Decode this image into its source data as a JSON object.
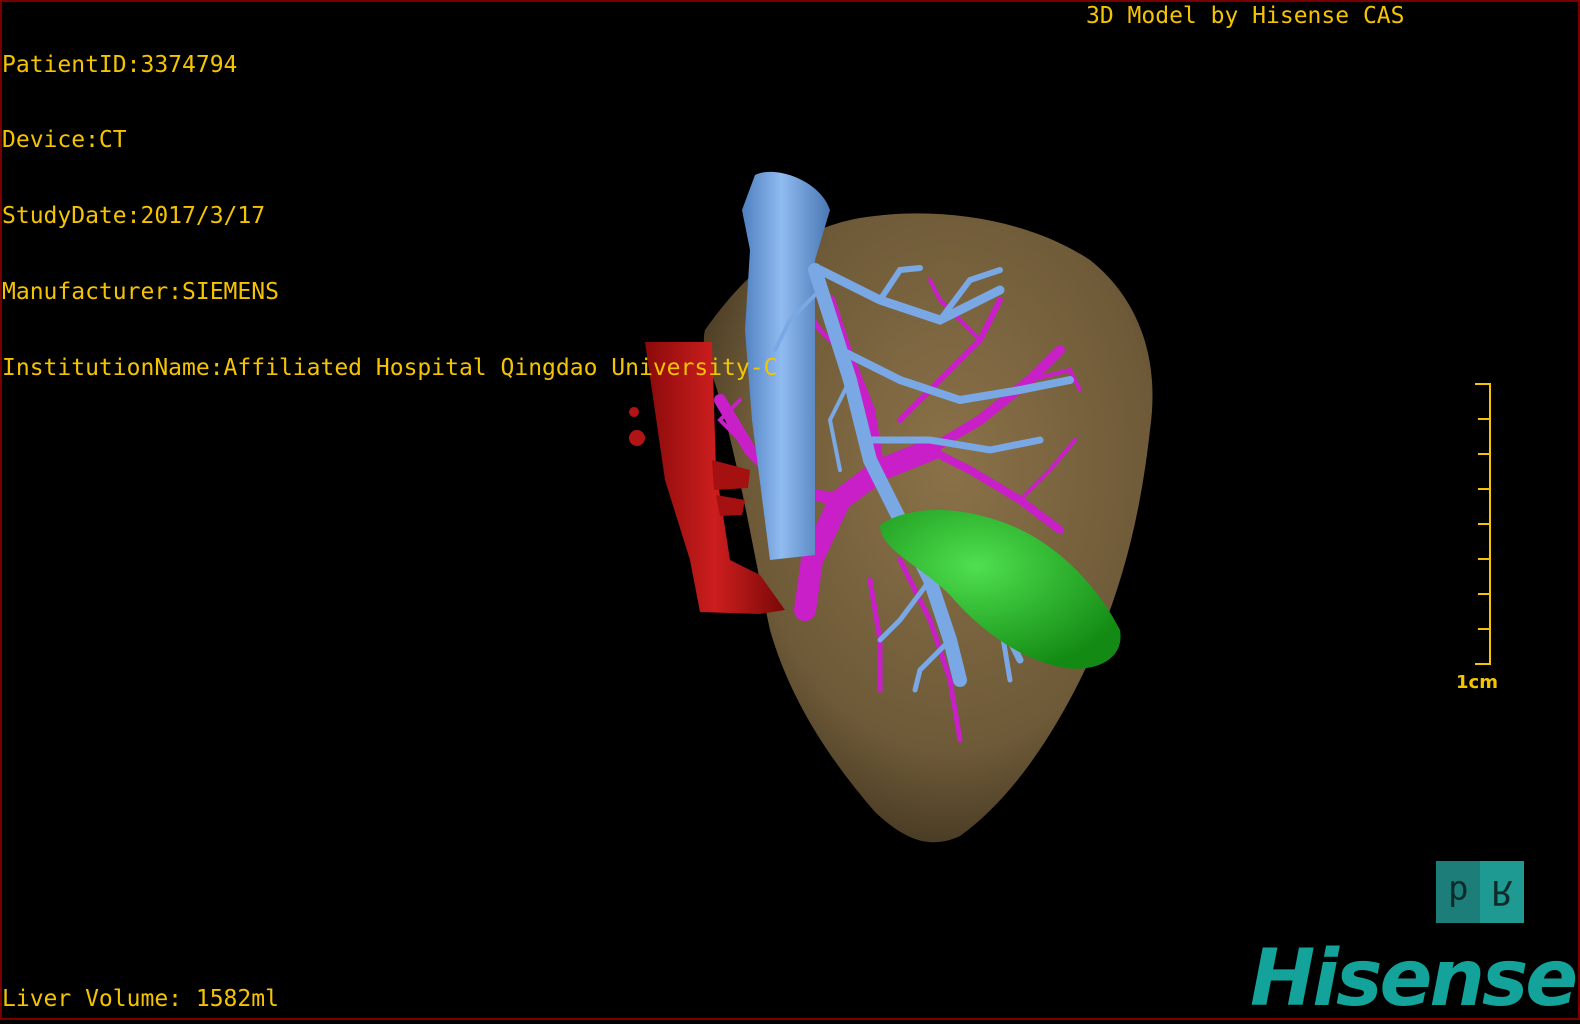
{
  "app": {
    "credit": "3D Model by Hisense CAS",
    "logo": "Hisense"
  },
  "dicom_info": [
    "PatientID:3374794",
    "Device:CT",
    "StudyDate:2017/3/17",
    "Manufacturer:SIEMENS",
    "InstitutionName:Affiliated Hospital Qingdao University-C"
  ],
  "volume_label": "Liver Volume: 1582ml",
  "scale_bar": {
    "label": "1cm"
  },
  "orientation_cube": {
    "left": "d",
    "right": "R",
    "icon": "orientation-cube-icon"
  },
  "colors": {
    "text": "#f5c400",
    "liver": "#7a6540",
    "vena_cava": "#6f9fd8",
    "aorta": "#b81414",
    "portal_vein": "#c81fc8",
    "gallbladder": "#1fb11f",
    "brand": "#13a39a"
  }
}
